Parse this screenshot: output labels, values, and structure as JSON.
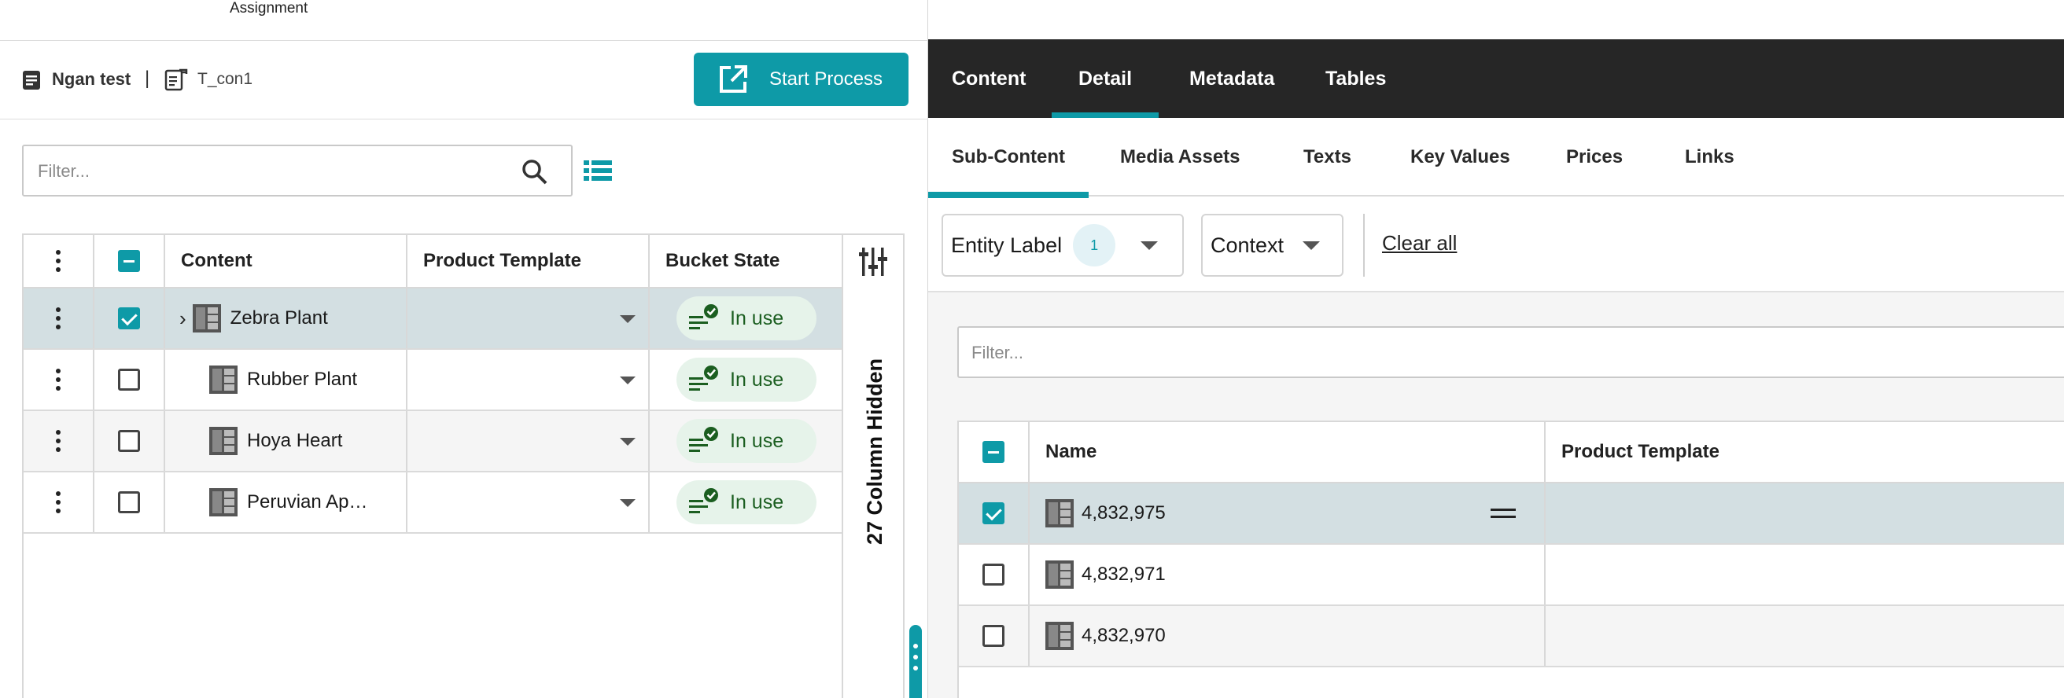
{
  "window": {
    "section_label": "Assignment"
  },
  "breadcrumb": {
    "main": "Ngan test",
    "separator": "|",
    "sub": "T_con1"
  },
  "toolbar": {
    "start_process_label": "Start Process"
  },
  "left_filter": {
    "placeholder": "Filter..."
  },
  "left_grid": {
    "columns": [
      "Content",
      "Product Template",
      "Bucket State"
    ],
    "rows": [
      {
        "name": "Zebra Plant",
        "checked": true,
        "expandable": true,
        "state": "In use"
      },
      {
        "name": "Rubber Plant",
        "checked": false,
        "expandable": false,
        "state": "In use"
      },
      {
        "name": "Hoya Heart",
        "checked": false,
        "expandable": false,
        "state": "In use"
      },
      {
        "name": "Peruvian Ap…",
        "checked": false,
        "expandable": false,
        "state": "In use"
      }
    ],
    "hidden_columns_label": "27 Column Hidden"
  },
  "detail_tabs": [
    "Content",
    "Detail",
    "Metadata",
    "Tables"
  ],
  "detail_active_tab": "Detail",
  "sub_tabs": [
    "Sub-Content",
    "Media Assets",
    "Texts",
    "Key Values",
    "Prices",
    "Links"
  ],
  "sub_active_tab": "Sub-Content",
  "facets": {
    "entity_label": "Entity Label",
    "entity_count": "1",
    "context": "Context",
    "clear_all": "Clear all"
  },
  "right_filter": {
    "placeholder": "Filter..."
  },
  "right_grid": {
    "columns": [
      "Name",
      "Product Template"
    ],
    "rows": [
      {
        "name": "4,832,975",
        "checked": true
      },
      {
        "name": "4,832,971",
        "checked": false
      },
      {
        "name": "4,832,970",
        "checked": false
      }
    ]
  },
  "colors": {
    "accent": "#0e9aa7",
    "tabbar": "#262626",
    "pill_bg": "#e6f3ea",
    "pill_text": "#1b5e20",
    "selected_row": "#d3dfe2"
  }
}
